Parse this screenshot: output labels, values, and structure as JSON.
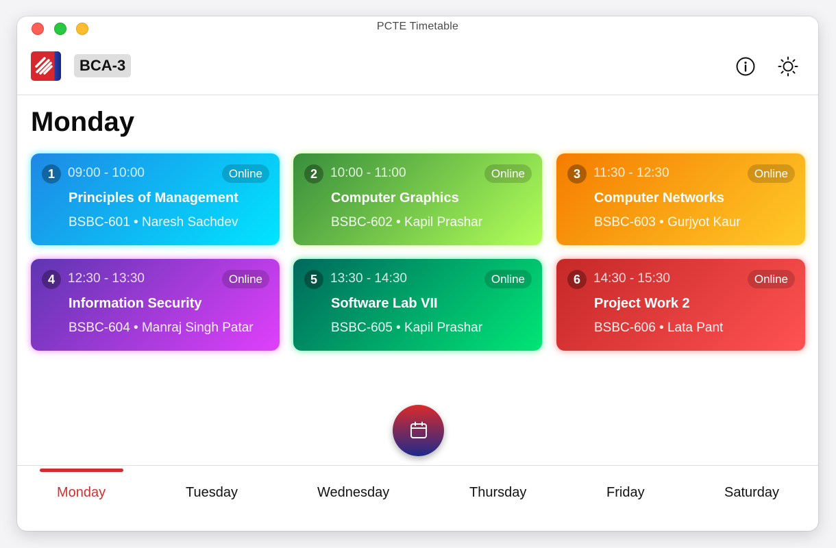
{
  "window": {
    "title": "PCTE Timetable"
  },
  "header": {
    "class_name": "BCA-3",
    "info_icon": "info-icon",
    "theme_icon": "sun-icon"
  },
  "day": {
    "title": "Monday"
  },
  "lectures": [
    {
      "number": "1",
      "time": "09:00 - 10:00",
      "mode": "Online",
      "subject": "Principles of Management",
      "code_teacher": "BSBC-601 • Naresh Sachdev",
      "colors": [
        "#1e88e5",
        "#00e5ff"
      ]
    },
    {
      "number": "2",
      "time": "10:00 - 11:00",
      "mode": "Online",
      "subject": "Computer Graphics",
      "code_teacher": "BSBC-602 • Kapil Prashar",
      "colors": [
        "#388e3c",
        "#b2ff59"
      ]
    },
    {
      "number": "3",
      "time": "11:30 - 12:30",
      "mode": "Online",
      "subject": "Computer Networks",
      "code_teacher": "BSBC-603 • Gurjyot Kaur",
      "colors": [
        "#f57c00",
        "#ffca28"
      ]
    },
    {
      "number": "4",
      "time": "12:30 - 13:30",
      "mode": "Online",
      "subject": "Information Security",
      "code_teacher": "BSBC-604 • Manraj Singh Patar",
      "colors": [
        "#5e35b1",
        "#e040fb"
      ]
    },
    {
      "number": "5",
      "time": "13:30 - 14:30",
      "mode": "Online",
      "subject": "Software Lab VII",
      "code_teacher": "BSBC-605 • Kapil Prashar",
      "colors": [
        "#00695c",
        "#00e676"
      ]
    },
    {
      "number": "6",
      "time": "14:30 - 15:30",
      "mode": "Online",
      "subject": "Project Work 2",
      "code_teacher": "BSBC-606 • Lata Pant",
      "colors": [
        "#c62828",
        "#ff5252"
      ]
    }
  ],
  "fab": {
    "icon": "calendar-icon"
  },
  "tabs": [
    {
      "label": "Monday",
      "active": true
    },
    {
      "label": "Tuesday",
      "active": false
    },
    {
      "label": "Wednesday",
      "active": false
    },
    {
      "label": "Thursday",
      "active": false
    },
    {
      "label": "Friday",
      "active": false
    },
    {
      "label": "Saturday",
      "active": false
    }
  ],
  "accent_color": "#d32f2f"
}
